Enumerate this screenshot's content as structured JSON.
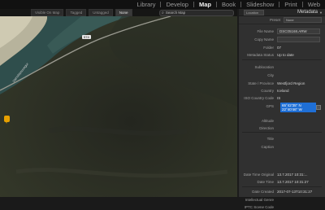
{
  "modules": [
    "Library",
    "Develop",
    "Map",
    "Book",
    "Slideshow",
    "Print",
    "Web"
  ],
  "active_module": "Map",
  "map": {
    "filters": [
      "Visible On Map",
      "Tagged",
      "Untagged",
      "None"
    ],
    "active_filter": "None",
    "search_placeholder": "Search Map",
    "road_badge": "574",
    "road_name": "Vatnsleysuvegur"
  },
  "panel": {
    "header_select": "Location",
    "title": "Metadata",
    "preset_label": "Preset",
    "preset_value": "None",
    "fields": [
      {
        "label": "File Name",
        "value": "DSC05168.ARW"
      },
      {
        "label": "Copy Name",
        "value": ""
      },
      {
        "label": "Folder",
        "value": "07"
      },
      {
        "label": "Metadata Status",
        "value": "Up to date"
      },
      {
        "label": "Sublocation",
        "value": ""
      },
      {
        "label": "City",
        "value": ""
      },
      {
        "label": "State / Province",
        "value": "Westfjord Region"
      },
      {
        "label": "Country",
        "value": "Iceland"
      },
      {
        "label": "ISO Country Code",
        "value": "IS"
      },
      {
        "label": "GPS",
        "value": "65°42'35\" N\n22°40'46\" W"
      },
      {
        "label": "Altitude",
        "value": ""
      },
      {
        "label": "Direction",
        "value": ""
      },
      {
        "label": "Title",
        "value": ""
      },
      {
        "label": "Caption",
        "value": ""
      },
      {
        "label": "Date Time Original",
        "value": "13.7.2017 10:31:..."
      },
      {
        "label": "Date Time",
        "value": "13.7.2017 10:31:27"
      },
      {
        "label": "Date Created",
        "value": "2017-07-13T10:31:27"
      },
      {
        "label": "Intellectual Genre",
        "value": ""
      },
      {
        "label": "IPTC Scene Code",
        "value": ""
      }
    ],
    "gps_line1": "65°42'35\" N",
    "gps_line2": "22°40'46\" W"
  }
}
